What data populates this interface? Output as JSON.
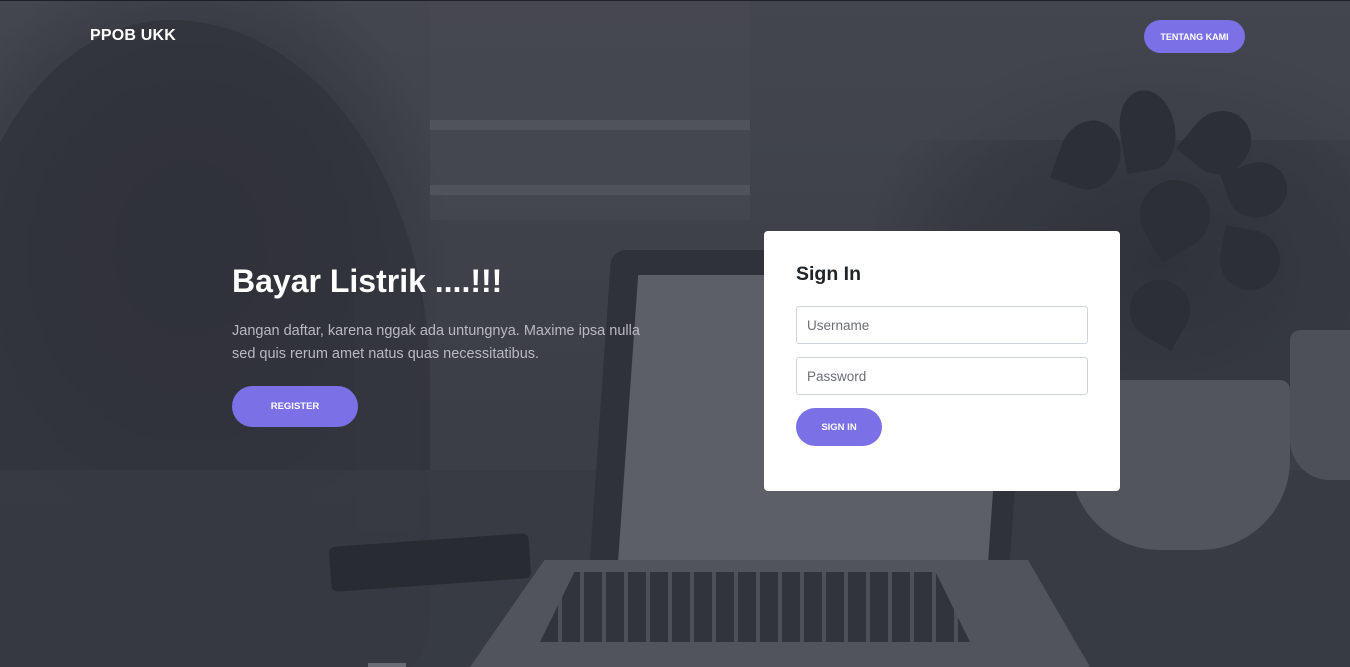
{
  "navbar": {
    "brand": "PPOB UKK",
    "about_button": "TENTANG KAMI"
  },
  "hero": {
    "title": "Bayar Listrik ....!!!",
    "text": "Jangan daftar, karena nggak ada untungnya. Maxime ipsa nulla sed quis rerum amet natus quas necessitatibus.",
    "register_button": "REGISTER"
  },
  "signin": {
    "title": "Sign In",
    "username_placeholder": "Username",
    "password_placeholder": "Password",
    "submit_button": "SIGN IN"
  },
  "colors": {
    "accent": "#7b70e6",
    "card_bg": "#ffffff",
    "background_overlay": "#3e4049"
  }
}
